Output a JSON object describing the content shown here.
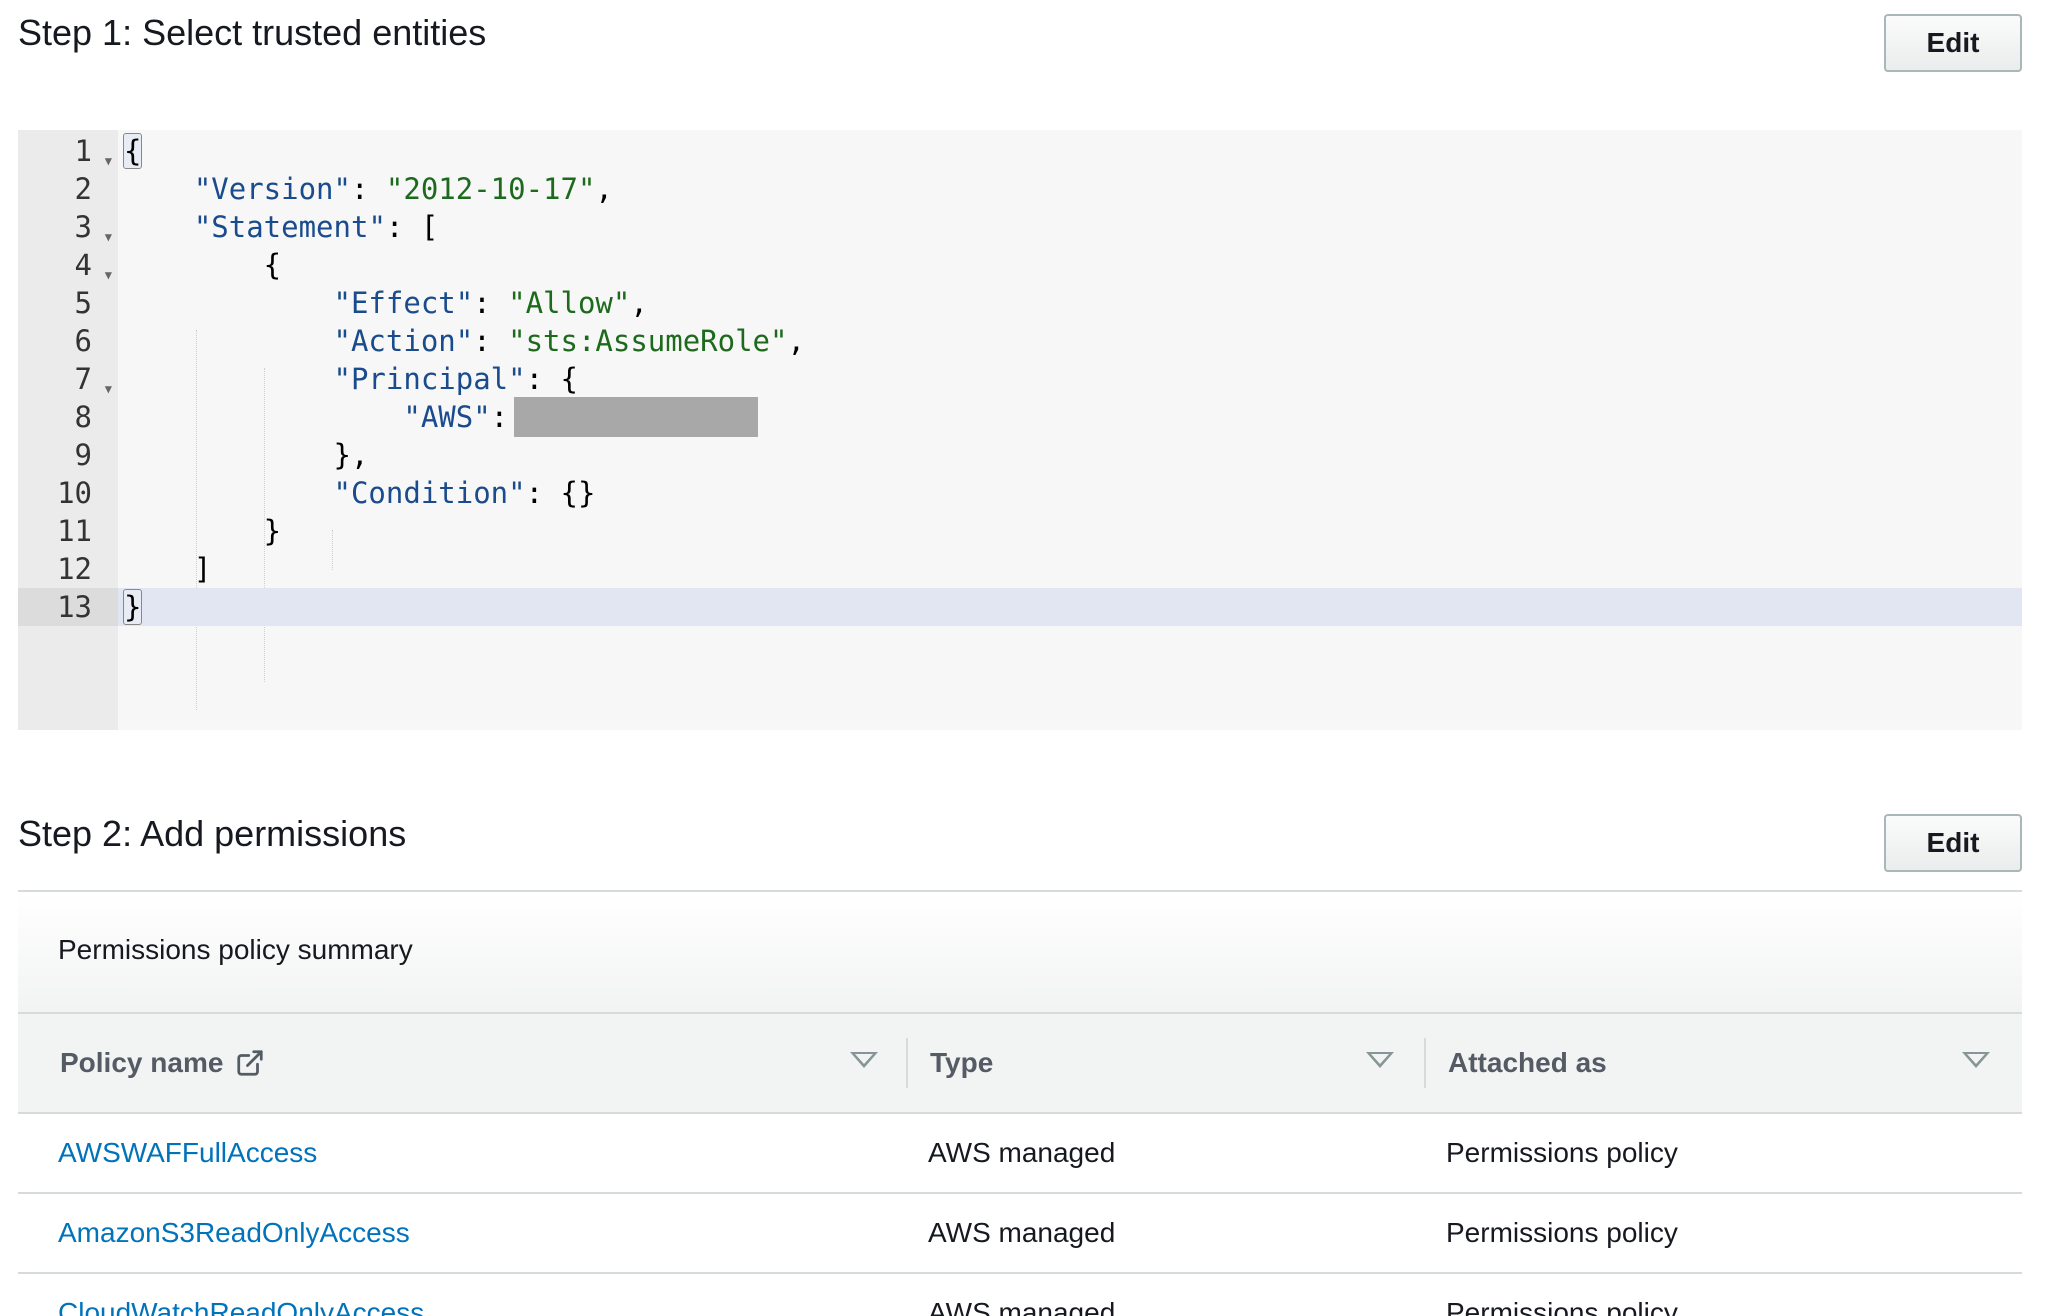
{
  "step1": {
    "title": "Step 1: Select trusted entities",
    "edit_label": "Edit"
  },
  "editor": {
    "lines": [
      {
        "num": "1"
      },
      {
        "num": "2"
      },
      {
        "num": "3"
      },
      {
        "num": "4"
      },
      {
        "num": "5"
      },
      {
        "num": "6"
      },
      {
        "num": "7"
      },
      {
        "num": "8"
      },
      {
        "num": "9"
      },
      {
        "num": "10"
      },
      {
        "num": "11"
      },
      {
        "num": "12"
      },
      {
        "num": "13"
      }
    ],
    "tokens": {
      "version_key": "\"Version\"",
      "version_val": "\"2012-10-17\"",
      "statement_key": "\"Statement\"",
      "effect_key": "\"Effect\"",
      "effect_val": "\"Allow\"",
      "action_key": "\"Action\"",
      "action_val": "\"sts:AssumeRole\"",
      "principal_key": "\"Principal\"",
      "aws_key": "\"AWS\"",
      "condition_key": "\"Condition\""
    },
    "active_line": "13"
  },
  "step2": {
    "title": "Step 2: Add permissions",
    "edit_label": "Edit",
    "panel_title": "Permissions policy summary",
    "columns": {
      "policy_name": "Policy name",
      "type": "Type",
      "attached_as": "Attached as"
    },
    "rows": [
      {
        "name": "AWSWAFFullAccess",
        "type": "AWS managed",
        "attached": "Permissions policy"
      },
      {
        "name": "AmazonS3ReadOnlyAccess",
        "type": "AWS managed",
        "attached": "Permissions policy"
      },
      {
        "name": "CloudWatchReadOnlyAccess",
        "type": "AWS managed",
        "attached": "Permissions policy"
      }
    ]
  },
  "icons": {
    "external_link": "external-link-icon",
    "sort": "caret-down-icon",
    "fold": "fold-arrow-icon"
  }
}
